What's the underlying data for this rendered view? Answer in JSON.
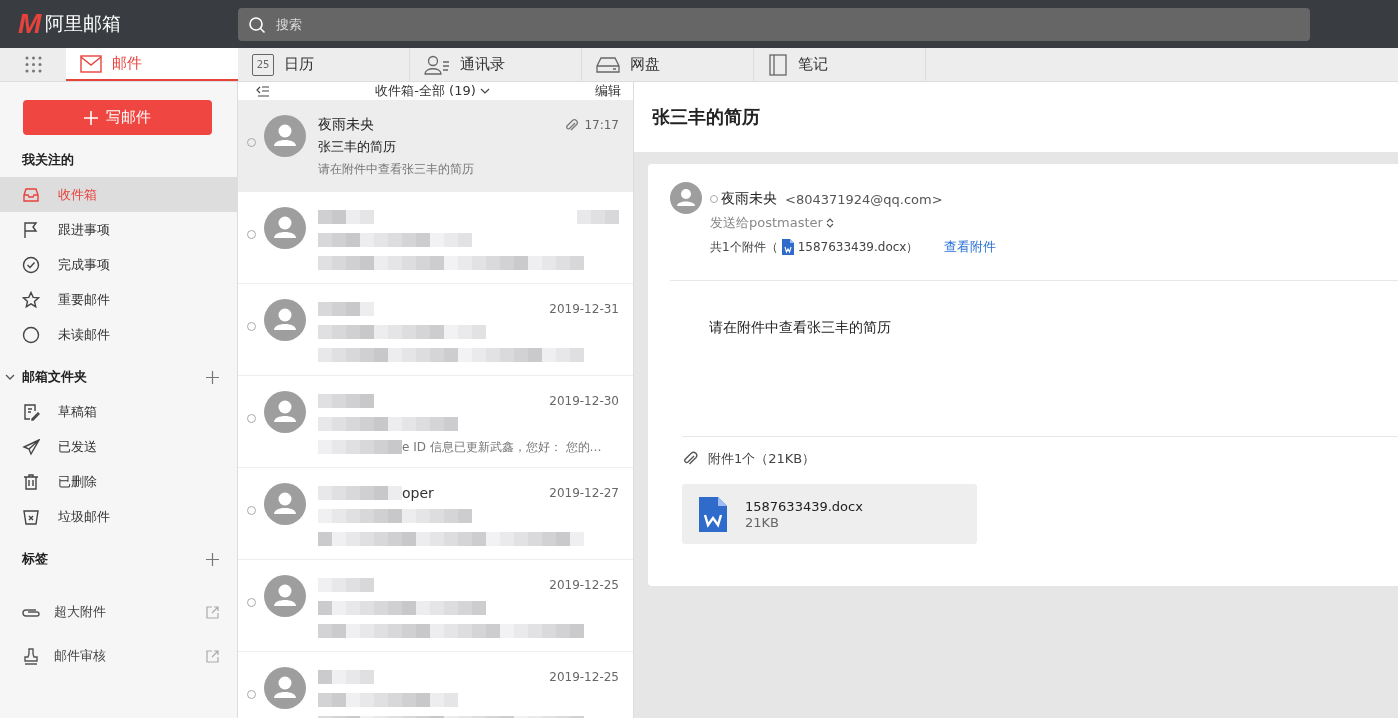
{
  "app": {
    "logo_mark": "M",
    "name": "阿里邮箱"
  },
  "search": {
    "placeholder": "搜索"
  },
  "nav_tabs": [
    {
      "kind": "mail",
      "label": "邮件",
      "selected": true
    },
    {
      "kind": "calendar",
      "label": "日历",
      "selected": false,
      "icon_text": "25"
    },
    {
      "kind": "contacts",
      "label": "通讯录",
      "selected": false
    },
    {
      "kind": "disk",
      "label": "网盘",
      "selected": false
    },
    {
      "kind": "notes",
      "label": "笔记",
      "selected": false
    }
  ],
  "compose_button": "写邮件",
  "sidebar": {
    "sections": [
      {
        "title": "我关注的",
        "collapsible": false,
        "addable": false,
        "items": [
          {
            "kind": "inbox",
            "label": "收件箱",
            "selected": true
          },
          {
            "kind": "flag",
            "label": "跟进事项",
            "selected": false
          },
          {
            "kind": "check",
            "label": "完成事项",
            "selected": false
          },
          {
            "kind": "star",
            "label": "重要邮件",
            "selected": false
          },
          {
            "kind": "circle",
            "label": "未读邮件",
            "selected": false
          }
        ]
      },
      {
        "title": "邮箱文件夹",
        "collapsible": true,
        "expanded": true,
        "addable": true,
        "items": [
          {
            "kind": "draft",
            "label": "草稿箱",
            "selected": false
          },
          {
            "kind": "sent",
            "label": "已发送",
            "selected": false
          },
          {
            "kind": "trash",
            "label": "已删除",
            "selected": false
          },
          {
            "kind": "spam",
            "label": "垃圾邮件",
            "selected": false
          }
        ]
      },
      {
        "title": "标签",
        "collapsible": false,
        "addable": true
      }
    ],
    "links": [
      {
        "kind": "clip",
        "label": "超大附件"
      },
      {
        "kind": "stamp",
        "label": "邮件审核"
      }
    ]
  },
  "mail_list": {
    "title": "收件箱-全部 (19)",
    "edit": "编辑",
    "rows": [
      {
        "redacted": false,
        "selected": true,
        "sender": "夜雨未央",
        "subject": "张三丰的简历",
        "preview": "请在附件中查看张三丰的简历",
        "time": "17:17",
        "attachment": true
      },
      {
        "redacted": true,
        "selected": false
      },
      {
        "redacted": true,
        "selected": false,
        "time": "2019-12-31"
      },
      {
        "redacted": true,
        "selected": false,
        "time": "2019-12-30",
        "preview_fragment": "e ID 信息已更新武鑫，您好： 您的…"
      },
      {
        "redacted": true,
        "selected": false,
        "time": "2019-12-27",
        "sender_fragment": "oper"
      },
      {
        "redacted": true,
        "selected": false,
        "time": "2019-12-25"
      },
      {
        "redacted": true,
        "selected": false,
        "time": "2019-12-25"
      }
    ]
  },
  "reader": {
    "subject": "张三丰的简历",
    "sender_name": "夜雨未央",
    "sender_email": "<804371924@qq.com>",
    "recipients": "发送给postmaster",
    "attachment_summary_prefix": "共1个附件（",
    "attachment_summary_file": "1587633439.docx）",
    "view_attachments": "查看附件",
    "body": "请在附件中查看张三丰的简历",
    "attachments_header": "附件1个（21KB）",
    "attachments": [
      {
        "name": "1587633439.docx",
        "size": "21KB"
      }
    ]
  }
}
